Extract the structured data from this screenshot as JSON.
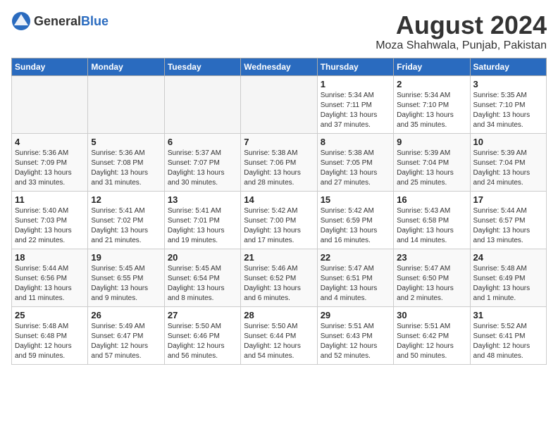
{
  "header": {
    "logo_general": "General",
    "logo_blue": "Blue",
    "title": "August 2024",
    "subtitle": "Moza Shahwala, Punjab, Pakistan"
  },
  "calendar": {
    "weekdays": [
      "Sunday",
      "Monday",
      "Tuesday",
      "Wednesday",
      "Thursday",
      "Friday",
      "Saturday"
    ],
    "weeks": [
      [
        {
          "day": "",
          "info": ""
        },
        {
          "day": "",
          "info": ""
        },
        {
          "day": "",
          "info": ""
        },
        {
          "day": "",
          "info": ""
        },
        {
          "day": "1",
          "info": "Sunrise: 5:34 AM\nSunset: 7:11 PM\nDaylight: 13 hours\nand 37 minutes."
        },
        {
          "day": "2",
          "info": "Sunrise: 5:34 AM\nSunset: 7:10 PM\nDaylight: 13 hours\nand 35 minutes."
        },
        {
          "day": "3",
          "info": "Sunrise: 5:35 AM\nSunset: 7:10 PM\nDaylight: 13 hours\nand 34 minutes."
        }
      ],
      [
        {
          "day": "4",
          "info": "Sunrise: 5:36 AM\nSunset: 7:09 PM\nDaylight: 13 hours\nand 33 minutes."
        },
        {
          "day": "5",
          "info": "Sunrise: 5:36 AM\nSunset: 7:08 PM\nDaylight: 13 hours\nand 31 minutes."
        },
        {
          "day": "6",
          "info": "Sunrise: 5:37 AM\nSunset: 7:07 PM\nDaylight: 13 hours\nand 30 minutes."
        },
        {
          "day": "7",
          "info": "Sunrise: 5:38 AM\nSunset: 7:06 PM\nDaylight: 13 hours\nand 28 minutes."
        },
        {
          "day": "8",
          "info": "Sunrise: 5:38 AM\nSunset: 7:05 PM\nDaylight: 13 hours\nand 27 minutes."
        },
        {
          "day": "9",
          "info": "Sunrise: 5:39 AM\nSunset: 7:04 PM\nDaylight: 13 hours\nand 25 minutes."
        },
        {
          "day": "10",
          "info": "Sunrise: 5:39 AM\nSunset: 7:04 PM\nDaylight: 13 hours\nand 24 minutes."
        }
      ],
      [
        {
          "day": "11",
          "info": "Sunrise: 5:40 AM\nSunset: 7:03 PM\nDaylight: 13 hours\nand 22 minutes."
        },
        {
          "day": "12",
          "info": "Sunrise: 5:41 AM\nSunset: 7:02 PM\nDaylight: 13 hours\nand 21 minutes."
        },
        {
          "day": "13",
          "info": "Sunrise: 5:41 AM\nSunset: 7:01 PM\nDaylight: 13 hours\nand 19 minutes."
        },
        {
          "day": "14",
          "info": "Sunrise: 5:42 AM\nSunset: 7:00 PM\nDaylight: 13 hours\nand 17 minutes."
        },
        {
          "day": "15",
          "info": "Sunrise: 5:42 AM\nSunset: 6:59 PM\nDaylight: 13 hours\nand 16 minutes."
        },
        {
          "day": "16",
          "info": "Sunrise: 5:43 AM\nSunset: 6:58 PM\nDaylight: 13 hours\nand 14 minutes."
        },
        {
          "day": "17",
          "info": "Sunrise: 5:44 AM\nSunset: 6:57 PM\nDaylight: 13 hours\nand 13 minutes."
        }
      ],
      [
        {
          "day": "18",
          "info": "Sunrise: 5:44 AM\nSunset: 6:56 PM\nDaylight: 13 hours\nand 11 minutes."
        },
        {
          "day": "19",
          "info": "Sunrise: 5:45 AM\nSunset: 6:55 PM\nDaylight: 13 hours\nand 9 minutes."
        },
        {
          "day": "20",
          "info": "Sunrise: 5:45 AM\nSunset: 6:54 PM\nDaylight: 13 hours\nand 8 minutes."
        },
        {
          "day": "21",
          "info": "Sunrise: 5:46 AM\nSunset: 6:52 PM\nDaylight: 13 hours\nand 6 minutes."
        },
        {
          "day": "22",
          "info": "Sunrise: 5:47 AM\nSunset: 6:51 PM\nDaylight: 13 hours\nand 4 minutes."
        },
        {
          "day": "23",
          "info": "Sunrise: 5:47 AM\nSunset: 6:50 PM\nDaylight: 13 hours\nand 2 minutes."
        },
        {
          "day": "24",
          "info": "Sunrise: 5:48 AM\nSunset: 6:49 PM\nDaylight: 13 hours\nand 1 minute."
        }
      ],
      [
        {
          "day": "25",
          "info": "Sunrise: 5:48 AM\nSunset: 6:48 PM\nDaylight: 12 hours\nand 59 minutes."
        },
        {
          "day": "26",
          "info": "Sunrise: 5:49 AM\nSunset: 6:47 PM\nDaylight: 12 hours\nand 57 minutes."
        },
        {
          "day": "27",
          "info": "Sunrise: 5:50 AM\nSunset: 6:46 PM\nDaylight: 12 hours\nand 56 minutes."
        },
        {
          "day": "28",
          "info": "Sunrise: 5:50 AM\nSunset: 6:44 PM\nDaylight: 12 hours\nand 54 minutes."
        },
        {
          "day": "29",
          "info": "Sunrise: 5:51 AM\nSunset: 6:43 PM\nDaylight: 12 hours\nand 52 minutes."
        },
        {
          "day": "30",
          "info": "Sunrise: 5:51 AM\nSunset: 6:42 PM\nDaylight: 12 hours\nand 50 minutes."
        },
        {
          "day": "31",
          "info": "Sunrise: 5:52 AM\nSunset: 6:41 PM\nDaylight: 12 hours\nand 48 minutes."
        }
      ]
    ]
  }
}
